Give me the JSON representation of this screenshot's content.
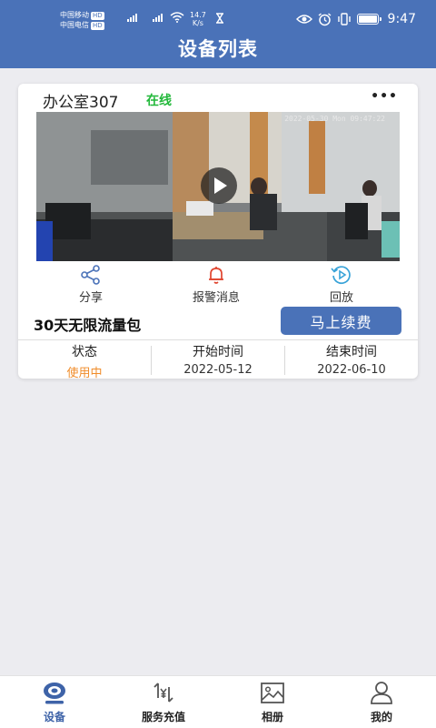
{
  "status_bar": {
    "carrier_1": "中国移动",
    "carrier_2": "中国电信",
    "hd_badge": "HD",
    "net_speed_value": "14.7",
    "net_speed_unit": "K/s",
    "time": "9:47",
    "icons": [
      "signal-icon",
      "wifi-icon",
      "hourglass-icon",
      "eye-icon",
      "alarm-icon",
      "vibrate-icon",
      "battery-icon"
    ]
  },
  "header": {
    "title": "设备列表",
    "background": "#4a72b8"
  },
  "device_card": {
    "name": "办公室307",
    "status": "在线",
    "status_color": "#22b83a",
    "more_label": "•••",
    "video_timestamp": "2022-05-30 Mon 09:47:22",
    "actions": [
      {
        "label": "分享",
        "icon": "share-icon"
      },
      {
        "label": "报警消息",
        "icon": "bell-icon"
      },
      {
        "label": "回放",
        "icon": "playback-icon"
      }
    ],
    "plan": {
      "name": "30天无限流量包",
      "renew_label": "马上续费",
      "columns": [
        {
          "header": "状态",
          "value": "使用中"
        },
        {
          "header": "开始时间",
          "value": "2022-05-12"
        },
        {
          "header": "结束时间",
          "value": "2022-06-10"
        }
      ]
    }
  },
  "tabbar": {
    "items": [
      {
        "label": "设备",
        "icon": "camera-icon",
        "active": true
      },
      {
        "label": "服务充值",
        "icon": "recharge-icon",
        "active": false
      },
      {
        "label": "相册",
        "icon": "album-icon",
        "active": false
      },
      {
        "label": "我的",
        "icon": "profile-icon",
        "active": false
      }
    ],
    "accent": "#3e63a8"
  }
}
